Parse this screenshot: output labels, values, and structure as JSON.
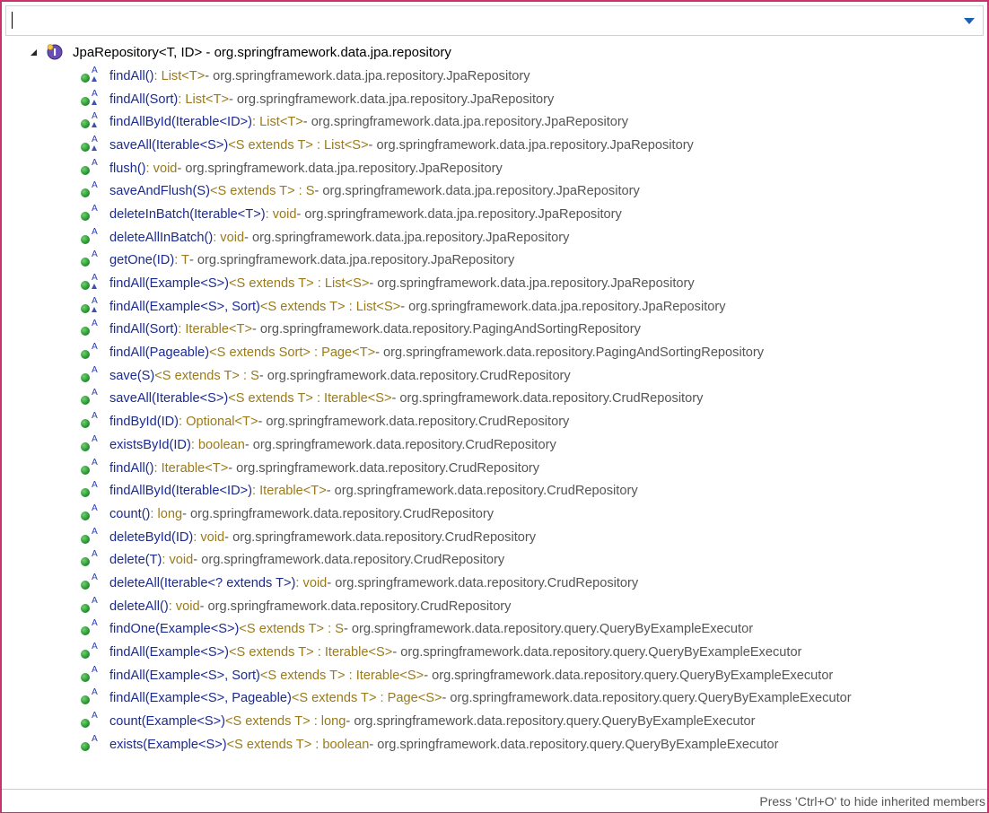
{
  "filter": {
    "value": "",
    "dropdown_icon": "chevron-down-icon"
  },
  "root": {
    "icon": "interface-icon",
    "label": "JpaRepository<T, ID> - org.springframework.data.jpa.repository"
  },
  "members": [
    {
      "sig": "findAll()",
      "type": " : List<T>",
      "pkg": " - org.springframework.data.jpa.repository.JpaRepository",
      "overrides": true
    },
    {
      "sig": "findAll(Sort)",
      "type": " : List<T>",
      "pkg": " - org.springframework.data.jpa.repository.JpaRepository",
      "overrides": true
    },
    {
      "sig": "findAllById(Iterable<ID>)",
      "type": " : List<T>",
      "pkg": " - org.springframework.data.jpa.repository.JpaRepository",
      "overrides": true
    },
    {
      "sig": "saveAll(Iterable<S>)",
      "type": " <S extends T> : List<S>",
      "pkg": " - org.springframework.data.jpa.repository.JpaRepository",
      "overrides": true
    },
    {
      "sig": "flush()",
      "type": " : void",
      "pkg": " - org.springframework.data.jpa.repository.JpaRepository",
      "overrides": false
    },
    {
      "sig": "saveAndFlush(S)",
      "type": " <S extends T> : S",
      "pkg": " - org.springframework.data.jpa.repository.JpaRepository",
      "overrides": false
    },
    {
      "sig": "deleteInBatch(Iterable<T>)",
      "type": " : void",
      "pkg": " - org.springframework.data.jpa.repository.JpaRepository",
      "overrides": false
    },
    {
      "sig": "deleteAllInBatch()",
      "type": " : void",
      "pkg": " - org.springframework.data.jpa.repository.JpaRepository",
      "overrides": false
    },
    {
      "sig": "getOne(ID)",
      "type": " : T",
      "pkg": " - org.springframework.data.jpa.repository.JpaRepository",
      "overrides": false
    },
    {
      "sig": "findAll(Example<S>)",
      "type": " <S extends T> : List<S>",
      "pkg": " - org.springframework.data.jpa.repository.JpaRepository",
      "overrides": true
    },
    {
      "sig": "findAll(Example<S>, Sort)",
      "type": " <S extends T> : List<S>",
      "pkg": " - org.springframework.data.jpa.repository.JpaRepository",
      "overrides": true
    },
    {
      "sig": "findAll(Sort)",
      "type": " : Iterable<T>",
      "pkg": " - org.springframework.data.repository.PagingAndSortingRepository",
      "overrides": false
    },
    {
      "sig": "findAll(Pageable)",
      "type": " <S extends Sort> : Page<T>",
      "pkg": " - org.springframework.data.repository.PagingAndSortingRepository",
      "overrides": false
    },
    {
      "sig": "save(S)",
      "type": " <S extends T> : S",
      "pkg": " - org.springframework.data.repository.CrudRepository",
      "overrides": false
    },
    {
      "sig": "saveAll(Iterable<S>)",
      "type": " <S extends T> : Iterable<S>",
      "pkg": " - org.springframework.data.repository.CrudRepository",
      "overrides": false
    },
    {
      "sig": "findById(ID)",
      "type": " : Optional<T>",
      "pkg": " - org.springframework.data.repository.CrudRepository",
      "overrides": false
    },
    {
      "sig": "existsById(ID)",
      "type": " : boolean",
      "pkg": " - org.springframework.data.repository.CrudRepository",
      "overrides": false
    },
    {
      "sig": "findAll()",
      "type": " : Iterable<T>",
      "pkg": " - org.springframework.data.repository.CrudRepository",
      "overrides": false
    },
    {
      "sig": "findAllById(Iterable<ID>)",
      "type": " : Iterable<T>",
      "pkg": " - org.springframework.data.repository.CrudRepository",
      "overrides": false
    },
    {
      "sig": "count()",
      "type": " : long",
      "pkg": " - org.springframework.data.repository.CrudRepository",
      "overrides": false
    },
    {
      "sig": "deleteById(ID)",
      "type": " : void",
      "pkg": " - org.springframework.data.repository.CrudRepository",
      "overrides": false
    },
    {
      "sig": "delete(T)",
      "type": " : void",
      "pkg": " - org.springframework.data.repository.CrudRepository",
      "overrides": false
    },
    {
      "sig": "deleteAll(Iterable<? extends T>)",
      "type": " : void",
      "pkg": " - org.springframework.data.repository.CrudRepository",
      "overrides": false
    },
    {
      "sig": "deleteAll()",
      "type": " : void",
      "pkg": " - org.springframework.data.repository.CrudRepository",
      "overrides": false
    },
    {
      "sig": "findOne(Example<S>)",
      "type": " <S extends T> : S",
      "pkg": " - org.springframework.data.repository.query.QueryByExampleExecutor",
      "overrides": false
    },
    {
      "sig": "findAll(Example<S>)",
      "type": " <S extends T> : Iterable<S>",
      "pkg": " - org.springframework.data.repository.query.QueryByExampleExecutor",
      "overrides": false
    },
    {
      "sig": "findAll(Example<S>, Sort)",
      "type": " <S extends T> : Iterable<S>",
      "pkg": " - org.springframework.data.repository.query.QueryByExampleExecutor",
      "overrides": false
    },
    {
      "sig": "findAll(Example<S>, Pageable)",
      "type": " <S extends T> : Page<S>",
      "pkg": " - org.springframework.data.repository.query.QueryByExampleExecutor",
      "overrides": false
    },
    {
      "sig": "count(Example<S>)",
      "type": " <S extends T> : long",
      "pkg": " - org.springframework.data.repository.query.QueryByExampleExecutor",
      "overrides": false
    },
    {
      "sig": "exists(Example<S>)",
      "type": " <S extends T> : boolean",
      "pkg": " - org.springframework.data.repository.query.QueryByExampleExecutor",
      "overrides": false
    }
  ],
  "status": {
    "text": "Press 'Ctrl+O' to hide inherited members"
  },
  "colors": {
    "frame_border": "#c8326e",
    "signature": "#1b2b8f",
    "return_type": "#9a7a1a",
    "package": "#555555",
    "method_dot": "#1e8a2a",
    "dropdown_arrow": "#1f5fb0"
  }
}
